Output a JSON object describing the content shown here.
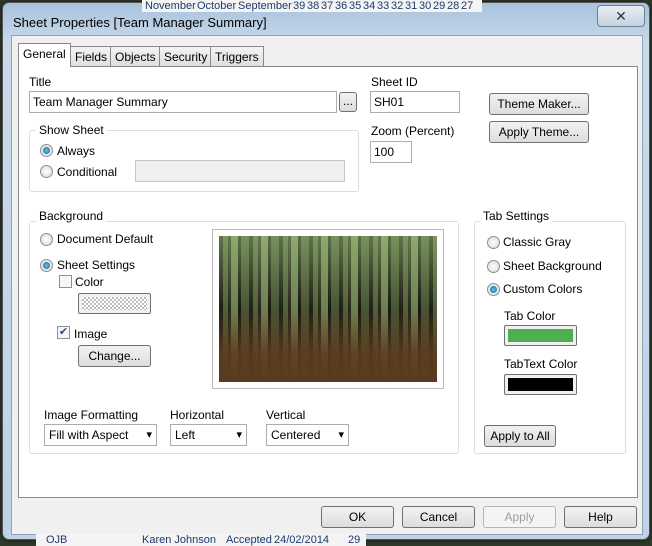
{
  "background_app": {
    "top_headers": [
      "November",
      "October",
      "September",
      "39",
      "38",
      "37",
      "36",
      "35",
      "34",
      "33",
      "32",
      "31",
      "30",
      "29",
      "28",
      "27"
    ],
    "bottom_row": [
      "OJB",
      "Karen Johnson",
      "Accepted",
      "24/02/2014",
      "29"
    ]
  },
  "window": {
    "title": "Sheet Properties [Team Manager Summary]",
    "close_icon": "close-icon"
  },
  "tabs": [
    {
      "label": "General",
      "active": true
    },
    {
      "label": "Fields"
    },
    {
      "label": "Objects"
    },
    {
      "label": "Security"
    },
    {
      "label": "Triggers"
    }
  ],
  "general": {
    "title_label": "Title",
    "title_value": "Team Manager Summary",
    "browse_label": "...",
    "sheet_id_label": "Sheet ID",
    "sheet_id_value": "SH01",
    "zoom_label": "Zoom (Percent)",
    "zoom_value": "100",
    "theme_maker": "Theme Maker...",
    "apply_theme": "Apply Theme...",
    "show_sheet": {
      "title": "Show Sheet",
      "always": "Always",
      "conditional": "Conditional",
      "selected": "Always",
      "conditional_value": ""
    },
    "background": {
      "title": "Background",
      "document_default": "Document Default",
      "sheet_settings": "Sheet Settings",
      "selected": "Sheet Settings",
      "color_label": "Color",
      "color_checked": false,
      "image_label": "Image",
      "image_checked": true,
      "change": "Change..."
    },
    "image_formatting": {
      "label": "Image Formatting",
      "value": "Fill with Aspect"
    },
    "horizontal": {
      "label": "Horizontal",
      "value": "Left"
    },
    "vertical": {
      "label": "Vertical",
      "value": "Centered"
    },
    "tab_settings": {
      "title": "Tab Settings",
      "classic_gray": "Classic Gray",
      "sheet_background": "Sheet Background",
      "custom_colors": "Custom Colors",
      "selected": "Custom Colors",
      "tab_color_label": "Tab Color",
      "tab_color": "#4caf50",
      "tab_text_color_label": "TabText Color",
      "tab_text_color": "#000000",
      "apply_to_all": "Apply to All"
    }
  },
  "buttons": {
    "ok": "OK",
    "cancel": "Cancel",
    "apply": "Apply",
    "help": "Help"
  }
}
